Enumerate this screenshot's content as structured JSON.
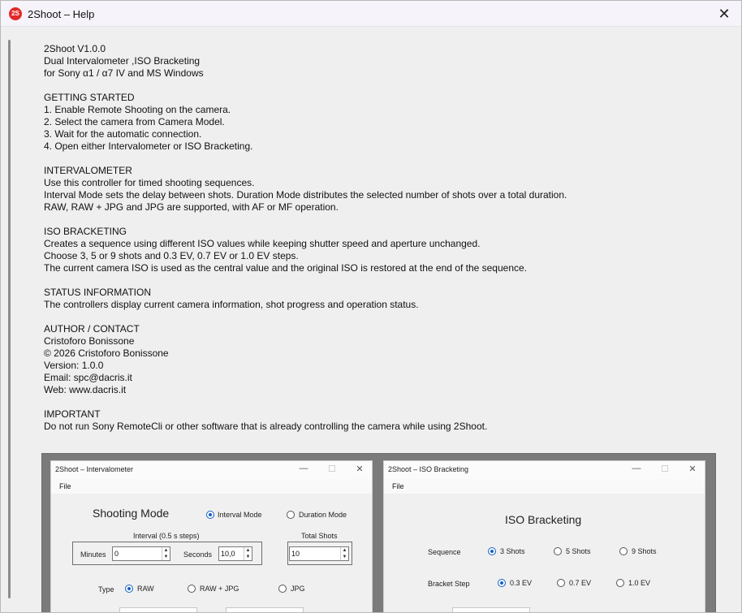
{
  "window": {
    "icon_text": "2S",
    "title": "2Shoot – Help",
    "close_glyph": "✕"
  },
  "help_lines": [
    "2Shoot V1.0.0",
    "Dual Intervalometer ,ISO Bracketing",
    "for Sony α1 / α7 IV and MS Windows",
    "",
    "GETTING STARTED",
    "1. Enable Remote Shooting on the camera.",
    "2. Select the camera from Camera Model.",
    "3. Wait for the automatic connection.",
    "4. Open either Intervalometer or ISO Bracketing.",
    "",
    "INTERVALOMETER",
    "Use this controller for timed shooting sequences.",
    "Interval Mode sets the delay between shots. Duration Mode distributes the selected number of shots over a total duration.",
    "RAW, RAW + JPG and JPG are supported, with AF or MF operation.",
    "",
    "ISO BRACKETING",
    "Creates a sequence using different ISO values while keeping shutter speed and aperture unchanged.",
    "Choose 3, 5 or 9 shots and 0.3 EV, 0.7 EV or 1.0 EV steps.",
    "The current camera ISO is used as the central value and the original ISO is restored at the end of the sequence.",
    "",
    "STATUS INFORMATION",
    "The controllers display current camera information, shot progress and operation status.",
    "",
    "AUTHOR / CONTACT",
    "Cristoforo Bonissone",
    "© 2026 Cristoforo Bonissone",
    "Version: 1.0.0",
    "Email: spc@dacris.it",
    "Web: www.dacris.it",
    "",
    "IMPORTANT",
    "Do not run Sony RemoteCli or other software that is already controlling the camera while using 2Shoot."
  ],
  "intervalometer": {
    "title": "2Shoot – Intervalometer",
    "minimize": "—",
    "maximize": "☐",
    "close": "✕",
    "menu_file": "File",
    "shooting_mode": "Shooting Mode",
    "interval_mode": "Interval Mode",
    "duration_mode": "Duration Mode",
    "interval_group": "Interval (0.5 s steps)",
    "total_shots_group": "Total Shots",
    "minutes_label": "Minutes",
    "minutes_value": "0",
    "seconds_label": "Seconds",
    "seconds_value": "10,0",
    "total_shots_value": "10",
    "type_label": "Type",
    "type_raw": "RAW",
    "type_raw_jpg": "RAW + JPG",
    "type_jpg": "JPG",
    "selected_mode": "Interval Mode",
    "selected_type": "RAW"
  },
  "iso_bracketing": {
    "title": "2Shoot – ISO Bracketing",
    "minimize": "—",
    "maximize": "☐",
    "close": "✕",
    "menu_file": "File",
    "heading": "ISO Bracketing",
    "sequence_label": "Sequence",
    "seq_3": "3 Shots",
    "seq_5": "5 Shots",
    "seq_9": "9 Shots",
    "step_label": "Bracket Step",
    "step_03": "0.3 EV",
    "step_07": "0.7 EV",
    "step_10": "1.0 EV",
    "selected_sequence": "3 Shots",
    "selected_step": "0.3 EV"
  },
  "colors": {
    "accent": "#1460c8",
    "app_icon": "#e02a2a"
  }
}
